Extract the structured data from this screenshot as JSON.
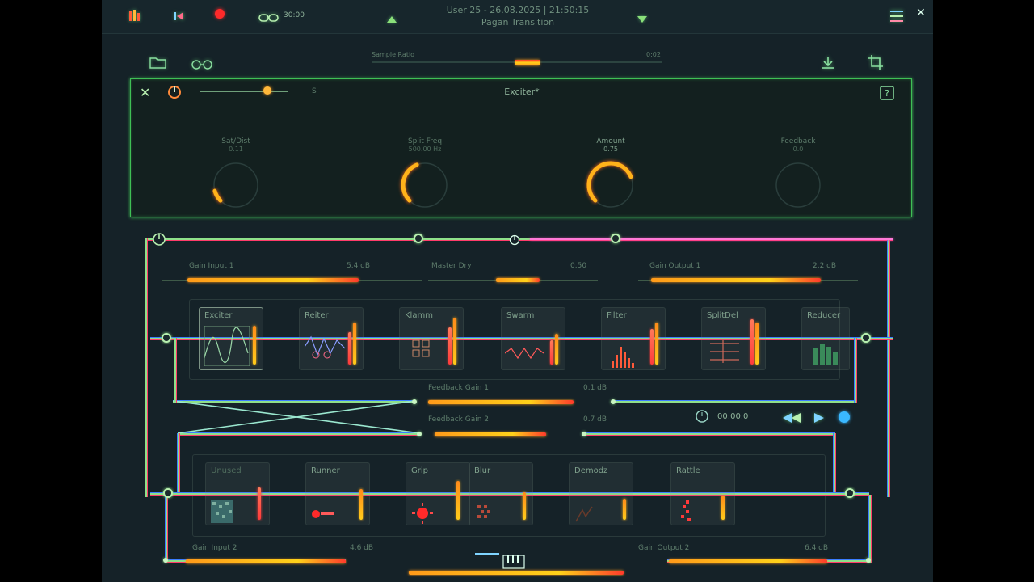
{
  "topbar": {
    "counter": "30:00",
    "session_line1": "User 25 - 26.08.2025 | 21:50:15",
    "session_line2": "Pagan Transition",
    "icons": [
      "mixer-icon",
      "skip-back-icon",
      "record-icon",
      "loop-icon",
      "up-arrow-icon",
      "down-arrow-icon",
      "menu-icon",
      "close-icon"
    ]
  },
  "toolbar": {
    "sample_ratio_label": "Sample Ratio",
    "sample_ratio_value": "0:02",
    "icons": [
      "folder-icon",
      "glasses-icon",
      "download-icon",
      "crop-icon"
    ]
  },
  "panel": {
    "title": "Exciter*",
    "slider_label": "S",
    "knobs": [
      {
        "label": "Sat/Dist",
        "value": "0.11",
        "fraction": 0.11
      },
      {
        "label": "Split Freq",
        "value": "500.00 Hz",
        "fraction": 0.42
      },
      {
        "label": "Amount",
        "value": "0.75",
        "fraction": 0.75
      },
      {
        "label": "Feedback",
        "value": "0.0",
        "fraction": 0.0
      }
    ]
  },
  "routing": {
    "gain_input": {
      "label": "Gain Input 1",
      "value": "5.4 dB"
    },
    "master_dry": {
      "label": "Master Dry",
      "value": "0.50"
    },
    "gain_output": {
      "label": "Gain Output 1",
      "value": "2.2 dB"
    },
    "feedback_gain_1": {
      "label": "Feedback Gain 1",
      "value": "0.1 dB"
    },
    "feedback_gain_2": {
      "label": "Feedback Gain 2",
      "value": "0.7 dB"
    },
    "time": "00:00.0",
    "gain_input_2": {
      "label": "Gain Input 2",
      "value": "4.6 dB"
    },
    "gain_output_2": {
      "label": "Gain Output 2",
      "value": "6.4 dB"
    }
  },
  "chain1": [
    "Exciter",
    "Reiter",
    "Klamm",
    "Swarm",
    "Filter",
    "SplitDel",
    "Reducer"
  ],
  "chain2": [
    "Unused",
    "Runner",
    "Grip",
    "Blur",
    "Demodz",
    "Rattle"
  ]
}
